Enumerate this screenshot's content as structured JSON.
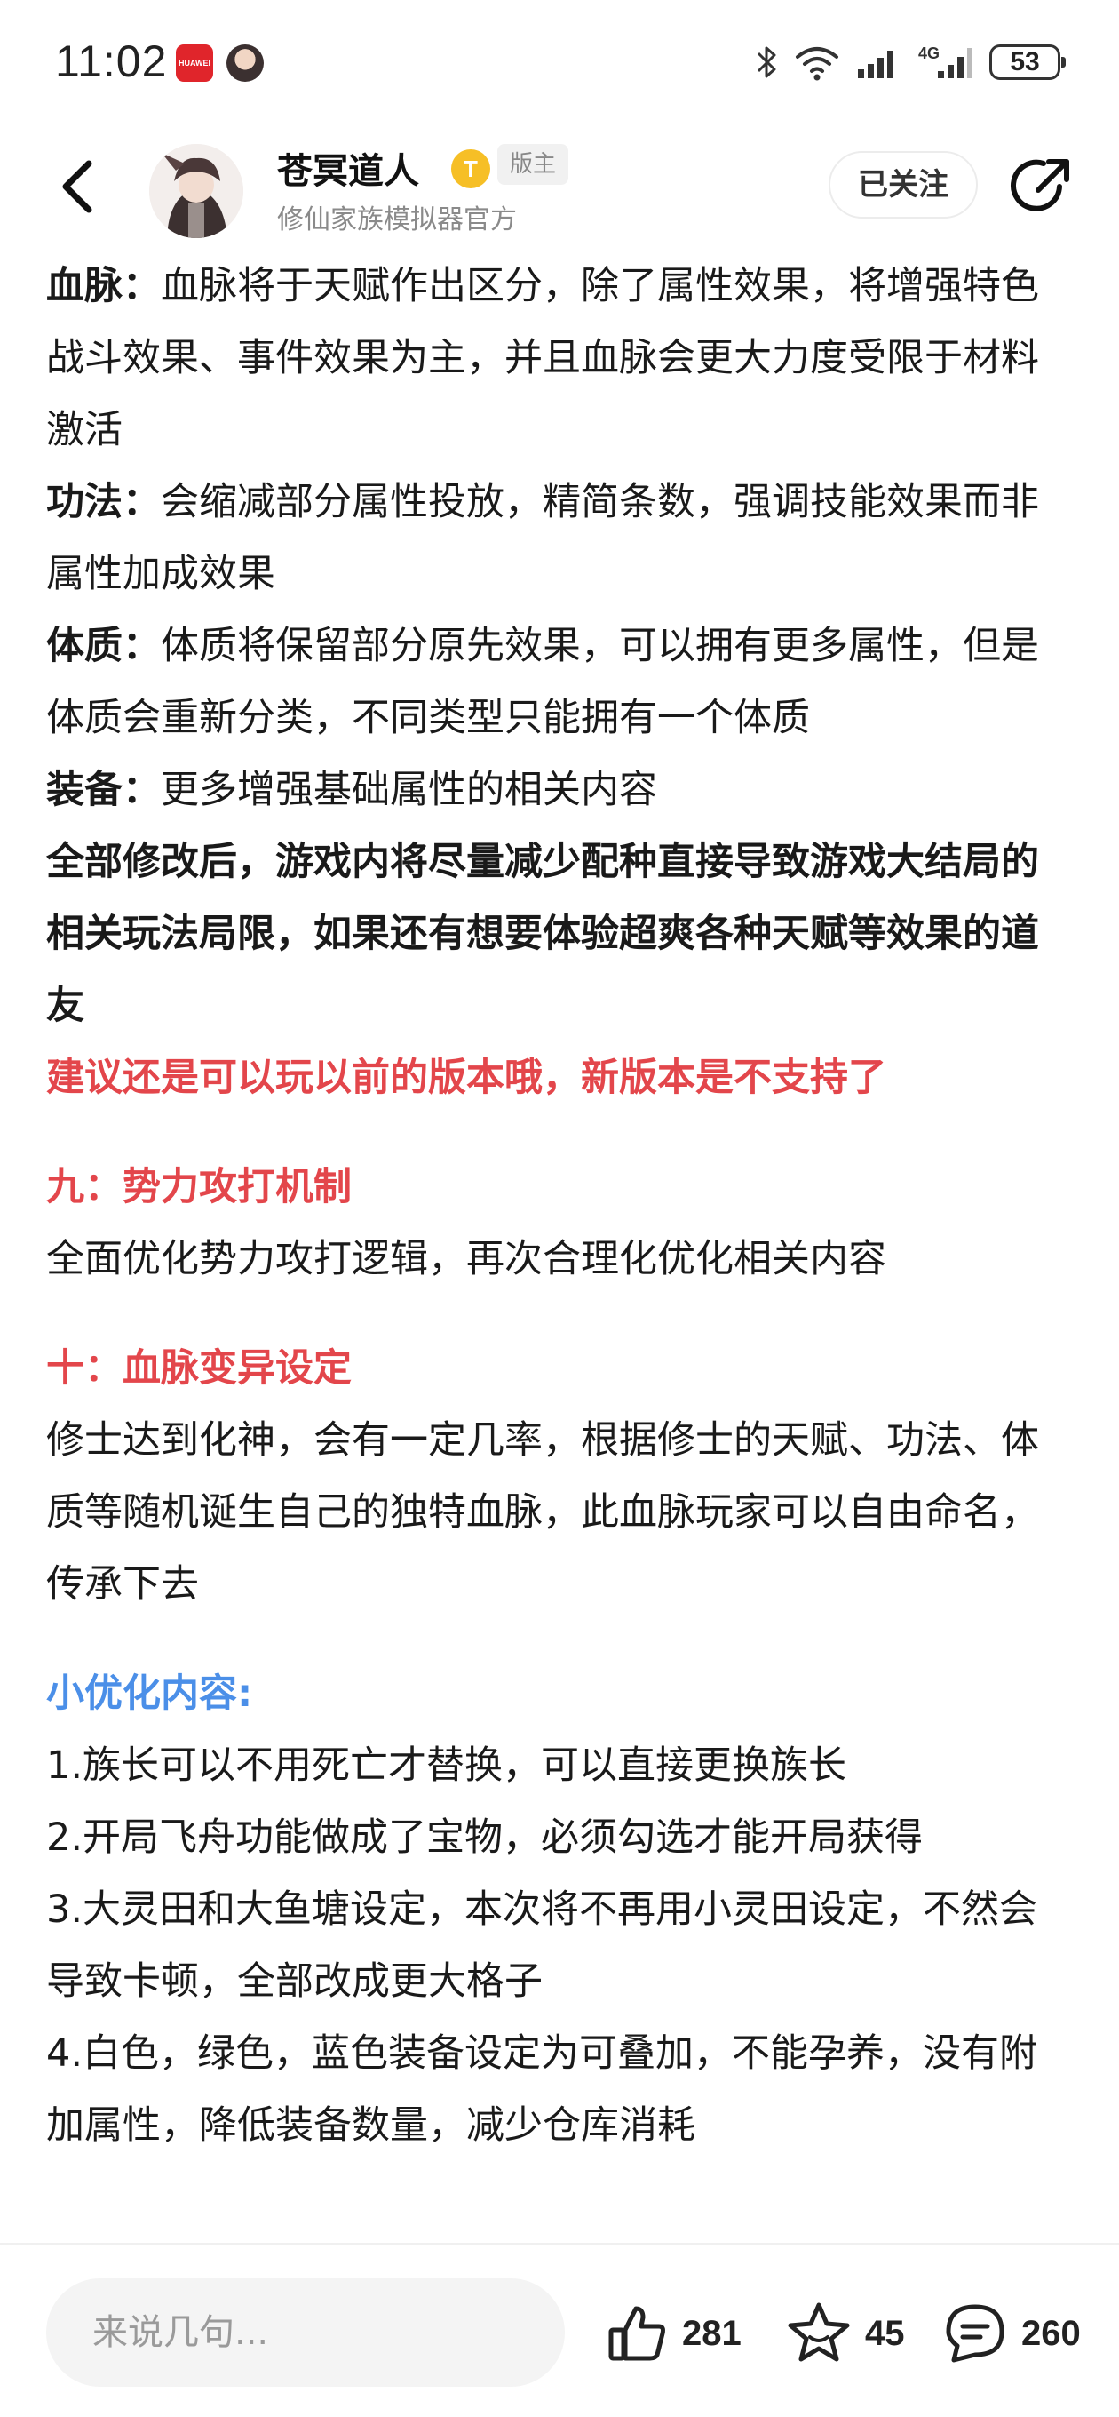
{
  "status_bar": {
    "time": "11:02",
    "app_badge": "HUAWEI",
    "network": "4G",
    "battery": "53"
  },
  "header": {
    "author_name": "苍冥道人",
    "level_badge": "T",
    "role_tag": "版主",
    "author_subtitle": "修仙家族模拟器官方",
    "follow_label": "已关注"
  },
  "content": {
    "bloodline_key": "血脉：",
    "bloodline_text": "血脉将于天赋作出区分，除了属性效果，将增强特色战斗效果、事件效果为主，并且血脉会更大力度受限于材料激活",
    "technique_key": "功法：",
    "technique_text": "会缩减部分属性投放，精简条数，强调技能效果而非属性加成效果",
    "constitution_key": "体质：",
    "constitution_text": "体质将保留部分原先效果，可以拥有更多属性，但是体质会重新分类，不同类型只能拥有一个体质",
    "equipment_key": "装备：",
    "equipment_text": "更多增强基础属性的相关内容",
    "summary_bold": "全部修改后，游戏内将尽量减少配种直接导致游戏大结局的相关玩法局限，如果还有想要体验超爽各种天赋等效果的道友",
    "summary_red": "建议还是可以玩以前的版本哦，新版本是不支持了",
    "section9_title": "九：势力攻打机制",
    "section9_text": "全面优化势力攻打逻辑，再次合理化优化相关内容",
    "section10_title": "十：血脉变异设定",
    "section10_text": "修士达到化神，会有一定几率，根据修士的天赋、功法、体质等随机诞生自己的独特血脉，此血脉玩家可以自由命名，传承下去",
    "minor_title": "小优化内容:",
    "minor_items": [
      "1.族长可以不用死亡才替换，可以直接更换族长",
      "2.开局飞舟功能做成了宝物，必须勾选才能开局获得",
      "3.大灵田和大鱼塘设定，本次将不再用小灵田设定，不然会导致卡顿，全部改成更大格子",
      "4.白色，绿色，蓝色装备设定为可叠加，不能孕养，没有附加属性，降低装备数量，减少仓库消耗"
    ]
  },
  "bottom_bar": {
    "comment_placeholder": "来说几句...",
    "likes": "281",
    "favorites": "45",
    "comments": "260"
  }
}
